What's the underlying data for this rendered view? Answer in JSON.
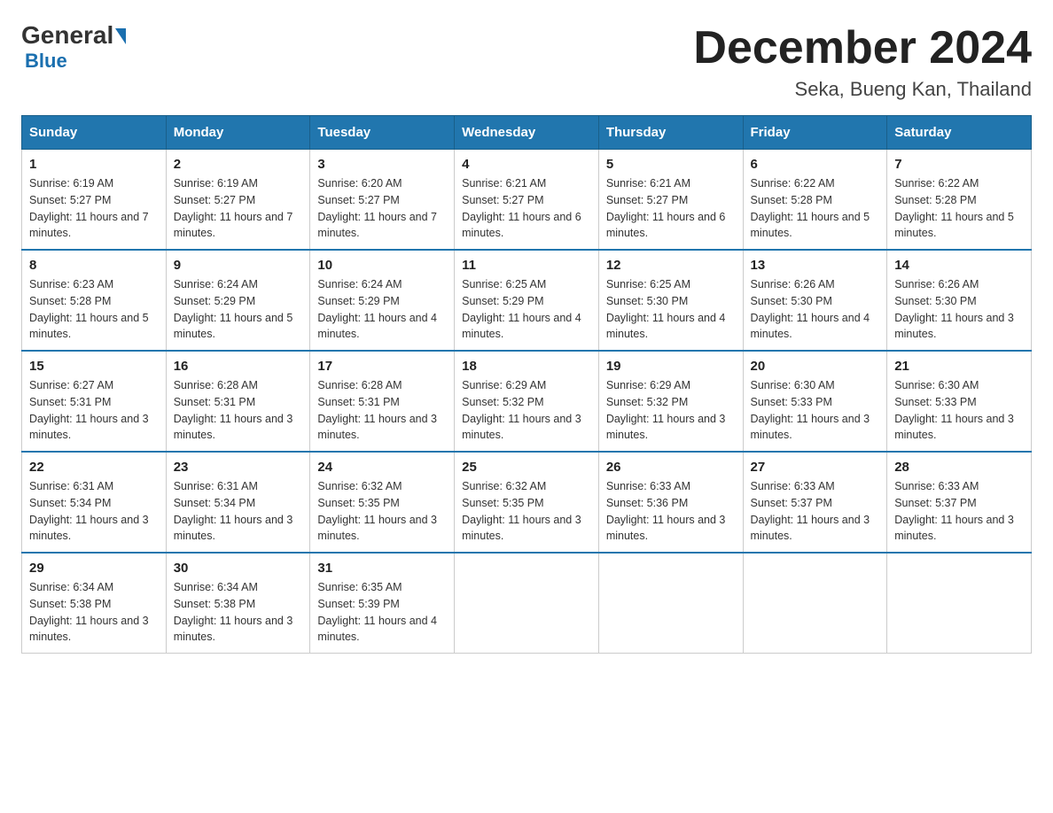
{
  "header": {
    "logo_general": "General",
    "logo_blue": "Blue",
    "main_title": "December 2024",
    "subtitle": "Seka, Bueng Kan, Thailand"
  },
  "days_of_week": [
    "Sunday",
    "Monday",
    "Tuesday",
    "Wednesday",
    "Thursday",
    "Friday",
    "Saturday"
  ],
  "weeks": [
    [
      {
        "day": "1",
        "sunrise": "6:19 AM",
        "sunset": "5:27 PM",
        "daylight": "11 hours and 7 minutes."
      },
      {
        "day": "2",
        "sunrise": "6:19 AM",
        "sunset": "5:27 PM",
        "daylight": "11 hours and 7 minutes."
      },
      {
        "day": "3",
        "sunrise": "6:20 AM",
        "sunset": "5:27 PM",
        "daylight": "11 hours and 7 minutes."
      },
      {
        "day": "4",
        "sunrise": "6:21 AM",
        "sunset": "5:27 PM",
        "daylight": "11 hours and 6 minutes."
      },
      {
        "day": "5",
        "sunrise": "6:21 AM",
        "sunset": "5:27 PM",
        "daylight": "11 hours and 6 minutes."
      },
      {
        "day": "6",
        "sunrise": "6:22 AM",
        "sunset": "5:28 PM",
        "daylight": "11 hours and 5 minutes."
      },
      {
        "day": "7",
        "sunrise": "6:22 AM",
        "sunset": "5:28 PM",
        "daylight": "11 hours and 5 minutes."
      }
    ],
    [
      {
        "day": "8",
        "sunrise": "6:23 AM",
        "sunset": "5:28 PM",
        "daylight": "11 hours and 5 minutes."
      },
      {
        "day": "9",
        "sunrise": "6:24 AM",
        "sunset": "5:29 PM",
        "daylight": "11 hours and 5 minutes."
      },
      {
        "day": "10",
        "sunrise": "6:24 AM",
        "sunset": "5:29 PM",
        "daylight": "11 hours and 4 minutes."
      },
      {
        "day": "11",
        "sunrise": "6:25 AM",
        "sunset": "5:29 PM",
        "daylight": "11 hours and 4 minutes."
      },
      {
        "day": "12",
        "sunrise": "6:25 AM",
        "sunset": "5:30 PM",
        "daylight": "11 hours and 4 minutes."
      },
      {
        "day": "13",
        "sunrise": "6:26 AM",
        "sunset": "5:30 PM",
        "daylight": "11 hours and 4 minutes."
      },
      {
        "day": "14",
        "sunrise": "6:26 AM",
        "sunset": "5:30 PM",
        "daylight": "11 hours and 3 minutes."
      }
    ],
    [
      {
        "day": "15",
        "sunrise": "6:27 AM",
        "sunset": "5:31 PM",
        "daylight": "11 hours and 3 minutes."
      },
      {
        "day": "16",
        "sunrise": "6:28 AM",
        "sunset": "5:31 PM",
        "daylight": "11 hours and 3 minutes."
      },
      {
        "day": "17",
        "sunrise": "6:28 AM",
        "sunset": "5:31 PM",
        "daylight": "11 hours and 3 minutes."
      },
      {
        "day": "18",
        "sunrise": "6:29 AM",
        "sunset": "5:32 PM",
        "daylight": "11 hours and 3 minutes."
      },
      {
        "day": "19",
        "sunrise": "6:29 AM",
        "sunset": "5:32 PM",
        "daylight": "11 hours and 3 minutes."
      },
      {
        "day": "20",
        "sunrise": "6:30 AM",
        "sunset": "5:33 PM",
        "daylight": "11 hours and 3 minutes."
      },
      {
        "day": "21",
        "sunrise": "6:30 AM",
        "sunset": "5:33 PM",
        "daylight": "11 hours and 3 minutes."
      }
    ],
    [
      {
        "day": "22",
        "sunrise": "6:31 AM",
        "sunset": "5:34 PM",
        "daylight": "11 hours and 3 minutes."
      },
      {
        "day": "23",
        "sunrise": "6:31 AM",
        "sunset": "5:34 PM",
        "daylight": "11 hours and 3 minutes."
      },
      {
        "day": "24",
        "sunrise": "6:32 AM",
        "sunset": "5:35 PM",
        "daylight": "11 hours and 3 minutes."
      },
      {
        "day": "25",
        "sunrise": "6:32 AM",
        "sunset": "5:35 PM",
        "daylight": "11 hours and 3 minutes."
      },
      {
        "day": "26",
        "sunrise": "6:33 AM",
        "sunset": "5:36 PM",
        "daylight": "11 hours and 3 minutes."
      },
      {
        "day": "27",
        "sunrise": "6:33 AM",
        "sunset": "5:37 PM",
        "daylight": "11 hours and 3 minutes."
      },
      {
        "day": "28",
        "sunrise": "6:33 AM",
        "sunset": "5:37 PM",
        "daylight": "11 hours and 3 minutes."
      }
    ],
    [
      {
        "day": "29",
        "sunrise": "6:34 AM",
        "sunset": "5:38 PM",
        "daylight": "11 hours and 3 minutes."
      },
      {
        "day": "30",
        "sunrise": "6:34 AM",
        "sunset": "5:38 PM",
        "daylight": "11 hours and 3 minutes."
      },
      {
        "day": "31",
        "sunrise": "6:35 AM",
        "sunset": "5:39 PM",
        "daylight": "11 hours and 4 minutes."
      },
      null,
      null,
      null,
      null
    ]
  ]
}
